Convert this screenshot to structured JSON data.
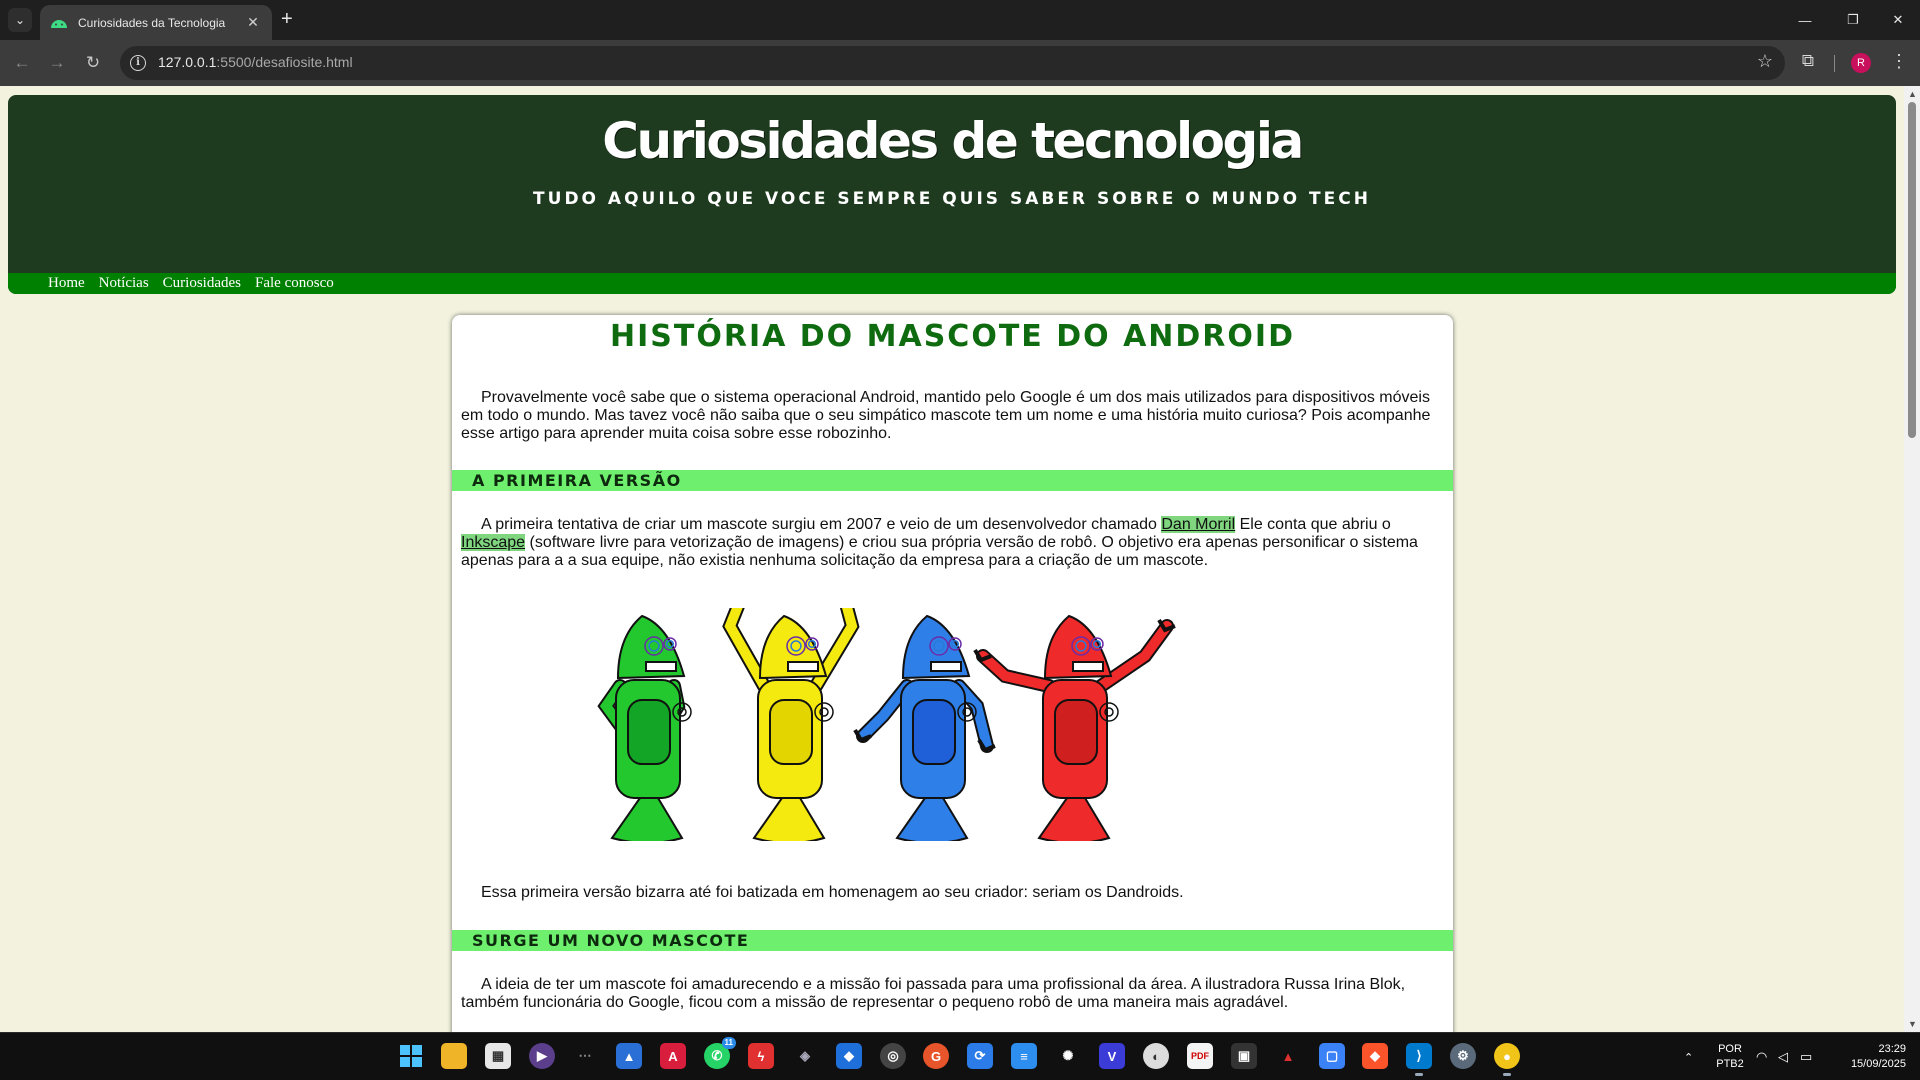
{
  "browser": {
    "tab_title": "Curiosidades da Tecnologia",
    "url_host": "127.0.0.1",
    "url_rest": ":5500/desafiosite.html",
    "profile_initial": "R"
  },
  "site": {
    "title": "Curiosidades de tecnologia",
    "subtitle": "Tudo aquilo que voce sempre quis saber sobre o mundo tech",
    "menu": [
      "Home",
      "Notícias",
      "Curiosidades",
      "Fale conosco"
    ]
  },
  "article": {
    "title": "História do mascote do Android",
    "intro": "Provavelmente você sabe que o sistema operacional Android, mantido pelo Google é um dos mais utilizados para dispositivos móveis em todo o mundo. Mas tavez você não saiba que o seu simpático mascote tem um nome e uma história muito curiosa? Pois acompanhe esse artigo para aprender muita coisa sobre esse robozinho.",
    "section1_title": "A primeira versão",
    "section1_text_a": "A primeira tentativa de criar um mascote surgiu em 2007 e veio de um desenvolvedor chamado ",
    "link_dan": "Dan Morril",
    "section1_text_b": " Ele conta que abriu o ",
    "link_inkscape": "Inkscape",
    "section1_text_c": " (software livre para vetorização de imagens) e criou sua própria versão de robô. O objetivo era apenas personificar o sistema apenas para a a sua equipe, não existia nenhuma solicitação da empresa para a criação de um mascote.",
    "image_caption": "Essa primeira versão bizarra até foi batizada em homenagem ao seu criador: seriam os Dandroids.",
    "section2_title": "Surge um novo mascote",
    "section2_text": "A ideia de ter um mascote foi amadurecendo e a missão foi passada para uma profissional da área. A ilustradora Russa Irina Blok, também funcionária do Google, ficou com a missão de representar o pequeno robô de uma maneira mais agradável."
  },
  "robots": {
    "colors": [
      "#22c82e",
      "#f5ea10",
      "#2f7fe8",
      "#ee2a2a"
    ],
    "dark_colors": [
      "#12a526",
      "#e3d600",
      "#1f5fd8",
      "#cf1f1f"
    ]
  },
  "taskbar": {
    "lang_line1": "POR",
    "lang_line2": "PTB2",
    "time": "23:29",
    "date": "15/09/2025",
    "whatsapp_badge": "11"
  }
}
